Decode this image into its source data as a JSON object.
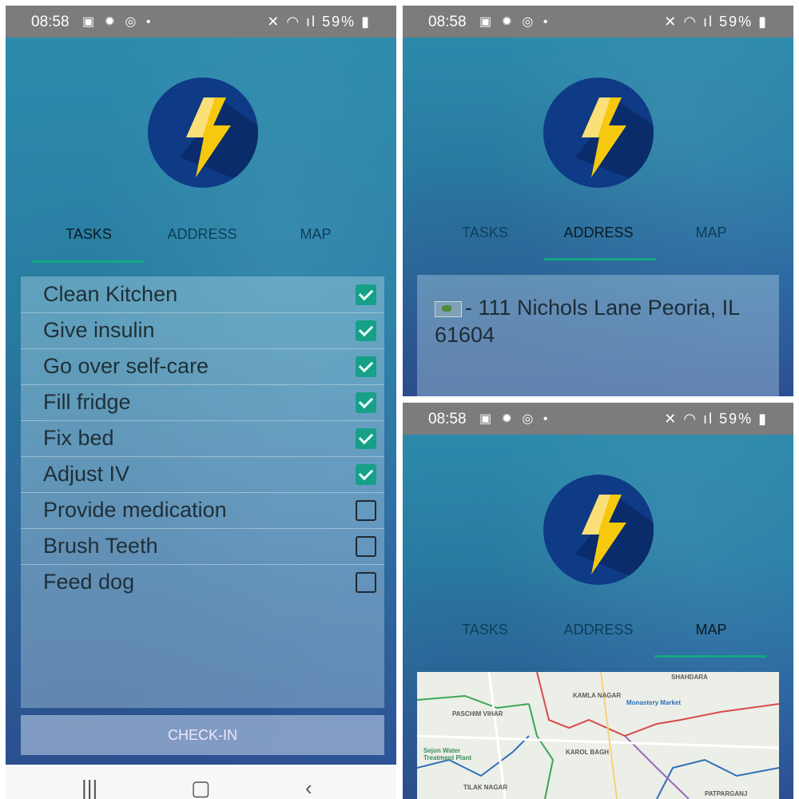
{
  "status_bar": {
    "time": "08:58",
    "battery": "59%"
  },
  "tabs": {
    "tasks": "TASKS",
    "address": "ADDRESS",
    "map": "MAP"
  },
  "tasks": [
    {
      "label": "Clean Kitchen",
      "checked": true
    },
    {
      "label": "Give insulin",
      "checked": true
    },
    {
      "label": "Go over self-care",
      "checked": true
    },
    {
      "label": "Fill fridge",
      "checked": true
    },
    {
      "label": "Fix bed",
      "checked": true
    },
    {
      "label": "Adjust IV",
      "checked": true
    },
    {
      "label": "Provide medication",
      "checked": false
    },
    {
      "label": "Brush Teeth",
      "checked": false
    },
    {
      "label": "Feed dog",
      "checked": false
    }
  ],
  "checkin_label": "CHECK-IN",
  "address": {
    "text": "- 111 Nichols Lane Peoria, IL 61604"
  },
  "map": {
    "labels": [
      "SHAHDARA",
      "KAMLA NAGAR",
      "Monastery Market",
      "PASCHIM VIHAR",
      "Sejon Water Treatment Plant",
      "KAROL BAGH",
      "TILAK NAGAR",
      "PATPARGANJ"
    ]
  },
  "colors": {
    "accent": "#13a784",
    "logo_bg": "#0f3a86",
    "bolt": "#f6c90e"
  }
}
